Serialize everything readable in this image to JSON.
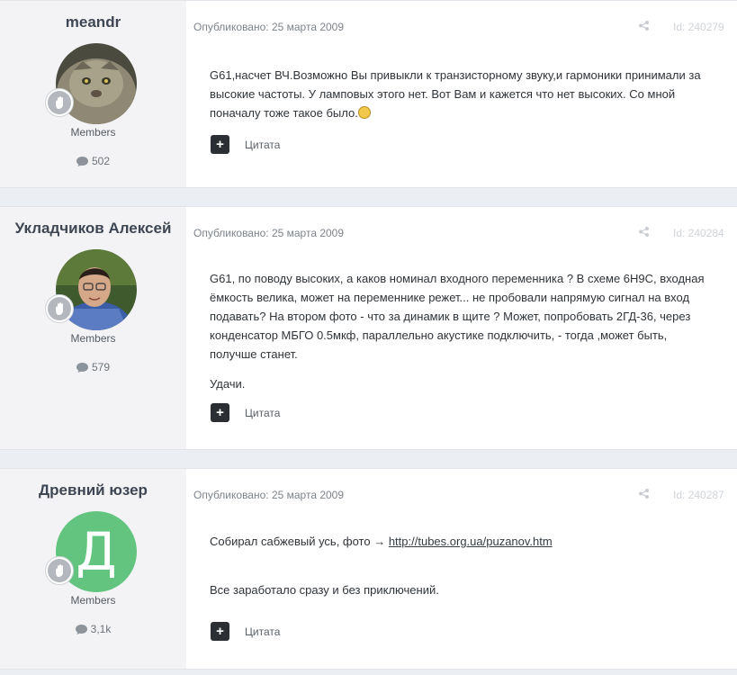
{
  "posts": [
    {
      "author": "meandr",
      "group": "Members",
      "post_count": "502",
      "published": "Опубликовано: 25 марта 2009",
      "post_id": "Id: 240279",
      "paragraphs": [
        "G61,насчет ВЧ.Возможно Вы привыкли к транзисторному звуку,и гармоники принимали за высокие частоты. У ламповых этого нет. Вот Вам и кажется что нет высоких. Со мной поначалу тоже такое было."
      ],
      "quote_label": "Цитата",
      "avatar_icon": "manul-cat-photo"
    },
    {
      "author": "Укладчиков Алексей",
      "group": "Members",
      "post_count": "579",
      "published": "Опубликовано: 25 марта 2009",
      "post_id": "Id: 240284",
      "paragraphs": [
        "G61, по поводу высоких, а каков номинал входного переменника ? В схеме 6Н9С, входная ёмкость велика, может на переменнике режет... не пробовали напрямую сигнал на вход подавать? На втором фото - что за динамик в щите ? Может, попробовать 2ГД-36, через конденсатор МБГО 0.5мкф, параллельно акустике подключить, - тогда ,может быть, получше станет.",
        "Удачи."
      ],
      "quote_label": "Цитата",
      "avatar_icon": "man-with-glasses-photo"
    },
    {
      "author": "Древний юзер",
      "group": "Members",
      "post_count": "3,1k",
      "published": "Опубликовано: 25 марта 2009",
      "post_id": "Id: 240287",
      "avatar_letter": "Д",
      "avatar_color": "#62c47f",
      "text_before_link": "Собирал сабжевый усь, фото → ",
      "link_text": "http://tubes.org.ua/puzanov.htm",
      "text_after": "Все заработало сразу и без приключений.",
      "quote_label": "Цитата"
    }
  ]
}
